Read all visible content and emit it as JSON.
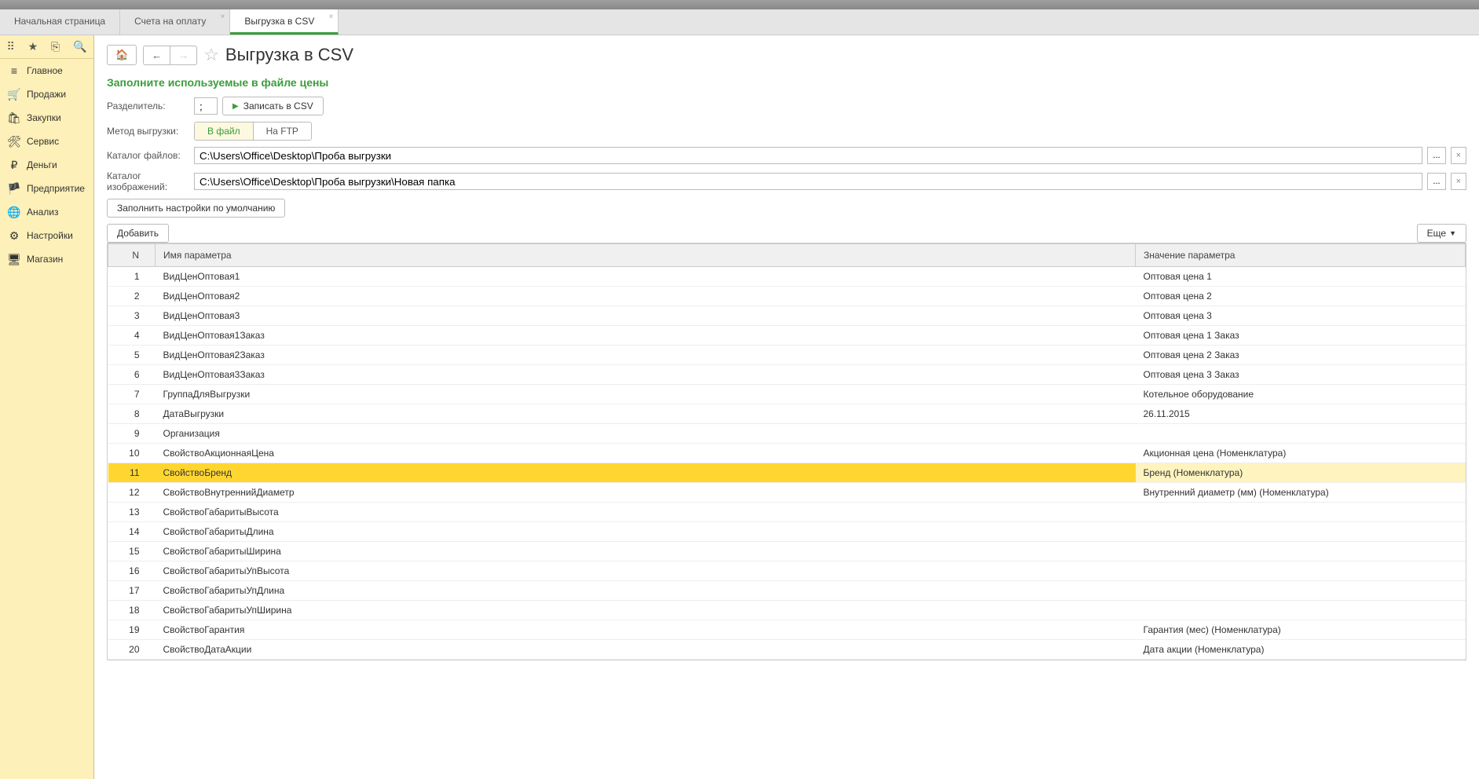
{
  "tabs": [
    {
      "label": "Начальная страница",
      "active": false,
      "closable": false
    },
    {
      "label": "Счета на оплату",
      "active": false,
      "closable": true
    },
    {
      "label": "Выгрузка в CSV",
      "active": true,
      "closable": true
    }
  ],
  "sidebar": {
    "items": [
      {
        "icon": "≡",
        "label": "Главное"
      },
      {
        "icon": "🛒",
        "label": "Продажи"
      },
      {
        "icon": "🛍",
        "label": "Закупки"
      },
      {
        "icon": "🛠",
        "label": "Сервис"
      },
      {
        "icon": "₽",
        "label": "Деньги"
      },
      {
        "icon": "🏴",
        "label": "Предприятие"
      },
      {
        "icon": "🌐",
        "label": "Анализ"
      },
      {
        "icon": "⚙",
        "label": "Настройки"
      },
      {
        "icon": "🖥",
        "label": "Магазин"
      }
    ]
  },
  "page": {
    "title": "Выгрузка в CSV",
    "green_heading": "Заполните используемые в файле цены",
    "labels": {
      "separator": "Разделитель:",
      "write_csv": "Записать в CSV",
      "method": "Метод выгрузки:",
      "to_file": "В файл",
      "to_ftp": "На FTP",
      "files_dir": "Каталог файлов:",
      "images_dir": "Каталог изображений:",
      "fill_defaults": "Заполнить настройки по умолчанию",
      "add": "Добавить",
      "more": "Еще"
    },
    "values": {
      "separator": ";",
      "files_dir": "C:\\Users\\Office\\Desktop\\Проба выгрузки",
      "images_dir": "C:\\Users\\Office\\Desktop\\Проба выгрузки\\Новая папка"
    }
  },
  "table": {
    "headers": {
      "n": "N",
      "name": "Имя параметра",
      "value": "Значение параметра"
    },
    "selected_index": 10,
    "rows": [
      {
        "n": "1",
        "name": "ВидЦенОптовая1",
        "value": "Оптовая цена 1"
      },
      {
        "n": "2",
        "name": "ВидЦенОптовая2",
        "value": "Оптовая цена 2"
      },
      {
        "n": "3",
        "name": "ВидЦенОптовая3",
        "value": "Оптовая цена 3"
      },
      {
        "n": "4",
        "name": "ВидЦенОптовая1Заказ",
        "value": "Оптовая цена 1 Заказ"
      },
      {
        "n": "5",
        "name": "ВидЦенОптовая2Заказ",
        "value": "Оптовая цена 2 Заказ"
      },
      {
        "n": "6",
        "name": "ВидЦенОптовая3Заказ",
        "value": "Оптовая цена 3 Заказ"
      },
      {
        "n": "7",
        "name": "ГруппаДляВыгрузки",
        "value": "Котельное оборудование"
      },
      {
        "n": "8",
        "name": "ДатаВыгрузки",
        "value": "26.11.2015"
      },
      {
        "n": "9",
        "name": "Организация",
        "value": ""
      },
      {
        "n": "10",
        "name": "СвойствоАкционнаяЦена",
        "value": "Акционная цена (Номенклатура)"
      },
      {
        "n": "11",
        "name": "СвойствоБренд",
        "value": "Бренд (Номенклатура)"
      },
      {
        "n": "12",
        "name": "СвойствоВнутреннийДиаметр",
        "value": "Внутренний диаметр (мм) (Номенклатура)"
      },
      {
        "n": "13",
        "name": "СвойствоГабаритыВысота",
        "value": ""
      },
      {
        "n": "14",
        "name": "СвойствоГабаритыДлина",
        "value": ""
      },
      {
        "n": "15",
        "name": "СвойствоГабаритыШирина",
        "value": ""
      },
      {
        "n": "16",
        "name": "СвойствоГабаритыУпВысота",
        "value": ""
      },
      {
        "n": "17",
        "name": "СвойствоГабаритыУпДлина",
        "value": ""
      },
      {
        "n": "18",
        "name": "СвойствоГабаритыУпШирина",
        "value": ""
      },
      {
        "n": "19",
        "name": "СвойствоГарантия",
        "value": "Гарантия (мес) (Номенклатура)"
      },
      {
        "n": "20",
        "name": "СвойствоДатаАкции",
        "value": "Дата акции (Номенклатура)"
      }
    ]
  }
}
